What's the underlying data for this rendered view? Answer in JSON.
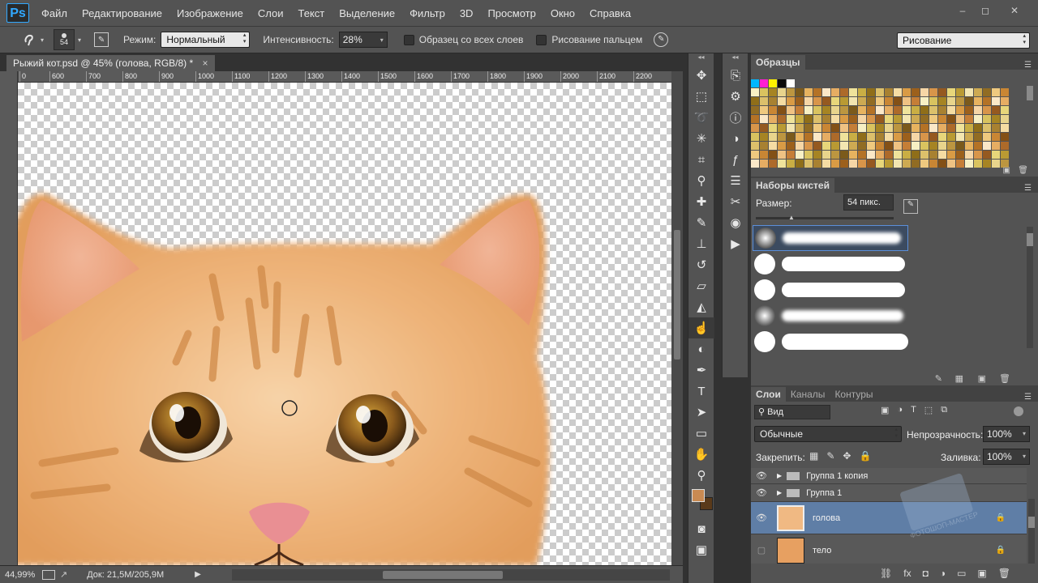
{
  "app": {
    "logo": "Ps"
  },
  "menu": [
    "Файл",
    "Редактирование",
    "Изображение",
    "Слои",
    "Текст",
    "Выделение",
    "Фильтр",
    "3D",
    "Просмотр",
    "Окно",
    "Справка"
  ],
  "window_controls": [
    "–",
    "◻",
    "✕"
  ],
  "options": {
    "brush_size": "54",
    "mode_label": "Режим:",
    "mode_value": "Нормальный",
    "intensity_label": "Интенсивность:",
    "intensity_value": "28%",
    "sample_all_label": "Образец со всех слоев",
    "finger_paint_label": "Рисование пальцем",
    "workspace": "Рисование"
  },
  "document": {
    "tab_title": "Рыжий кот.psd @ 45% (голова, RGB/8) *",
    "close": "×"
  },
  "ruler": {
    "ticks": [
      "0",
      "600",
      "700",
      "800",
      "900",
      "1000",
      "1100",
      "1200",
      "1300",
      "1400",
      "1500",
      "1600",
      "1700",
      "1800",
      "1900",
      "2000",
      "2100",
      "2200"
    ]
  },
  "status": {
    "zoom": "44,99%",
    "doc_info": "Док: 21,5M/205,9M"
  },
  "swatches_panel": {
    "title": "Образцы",
    "colors_top": [
      "#00b7ff",
      "#ff1fd2",
      "#fff200",
      "#0a0a0a",
      "#ffffff"
    ],
    "palette": [
      "#f7f0c4",
      "#efe39b",
      "#e7d67a",
      "#d9c35f",
      "#c9ae44",
      "#b99a33",
      "#a68423",
      "#8f6e19",
      "#f3e6b1",
      "#e8d48c",
      "#dcc06b",
      "#cdaa52",
      "#bc9640",
      "#a88131",
      "#916c23",
      "#7b5a1b",
      "#f5dca3",
      "#efc97f",
      "#e7b35f",
      "#d99b45",
      "#c98634",
      "#b47226",
      "#9c601c",
      "#835016",
      "#fbe8c8",
      "#f6d6a6",
      "#efc283",
      "#e6ad63",
      "#d8954a",
      "#c57e37",
      "#ad6a2a",
      "#955920"
    ]
  },
  "brush_presets": {
    "title": "Наборы кистей",
    "size_label": "Размер:",
    "size_value": "54 пикс."
  },
  "layers_panel": {
    "tabs": [
      "Слои",
      "Каналы",
      "Контуры"
    ],
    "kind_filter": "Вид",
    "blend_mode": "Обычные",
    "opacity_label": "Непрозрачность:",
    "opacity_value": "100%",
    "lock_label": "Закрепить:",
    "fill_label": "Заливка:",
    "fill_value": "100%",
    "layers": [
      {
        "name": "Группа 1 копия",
        "type": "group"
      },
      {
        "name": "Группа 1",
        "type": "group"
      },
      {
        "name": "голова",
        "type": "layer",
        "selected": true
      },
      {
        "name": "тело",
        "type": "layer"
      }
    ],
    "watermark_text": "ФОТОШОП-МАСТЕР"
  },
  "colors": {
    "foreground": "#c98a52",
    "background": "#5a3a1a",
    "selection": "#5f7ea6"
  }
}
